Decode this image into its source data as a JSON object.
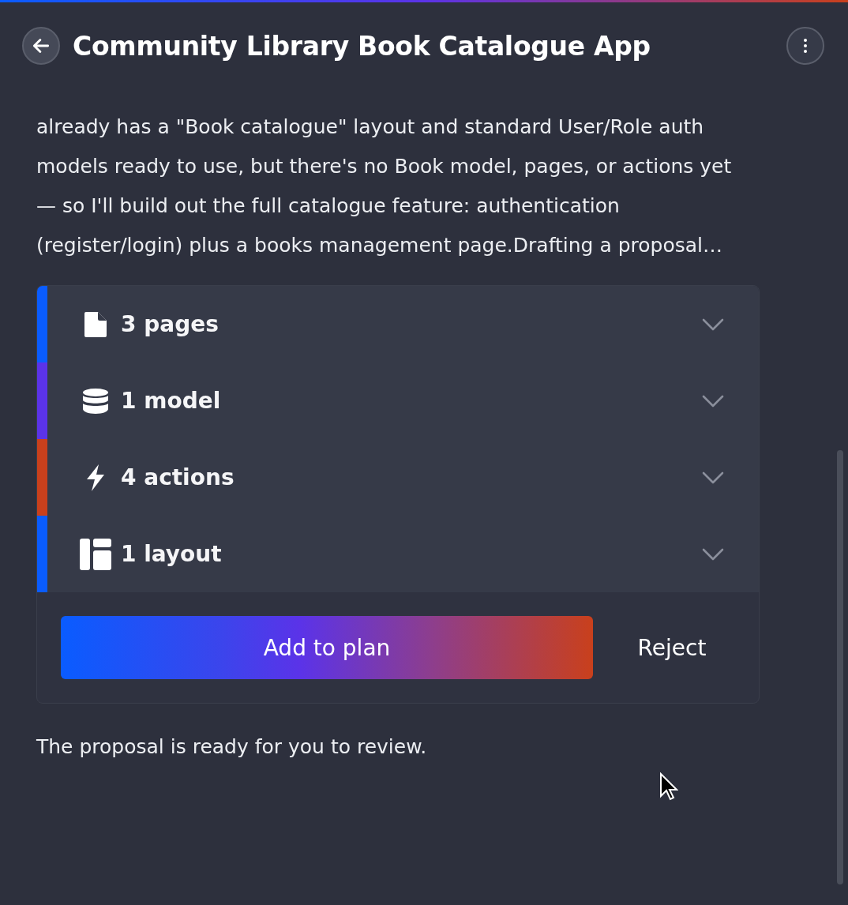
{
  "header": {
    "title": "Community Library Book Catalogue App"
  },
  "message": "already has a \"Book catalogue\" layout and standard User/Role auth models ready to use, but there's no Book model, pages, or actions yet — so I'll build out the full catalogue feature: authentication (register/login) plus a books management page.Drafting a proposal…",
  "proposal": {
    "items": [
      {
        "kind": "pages",
        "label": "3 pages",
        "color": "#0a5cff",
        "expanded": false
      },
      {
        "kind": "model",
        "label": "1 model",
        "color": "#5b33e8",
        "expanded": false
      },
      {
        "kind": "actions",
        "label": "4 actions",
        "color": "#c9401c",
        "expanded": false
      },
      {
        "kind": "layout",
        "label": "1 layout",
        "color": "#0a5cff",
        "expanded": false
      }
    ],
    "buttons": {
      "primary": "Add to plan",
      "secondary": "Reject"
    }
  },
  "footer_message": "The proposal is ready for you to review."
}
